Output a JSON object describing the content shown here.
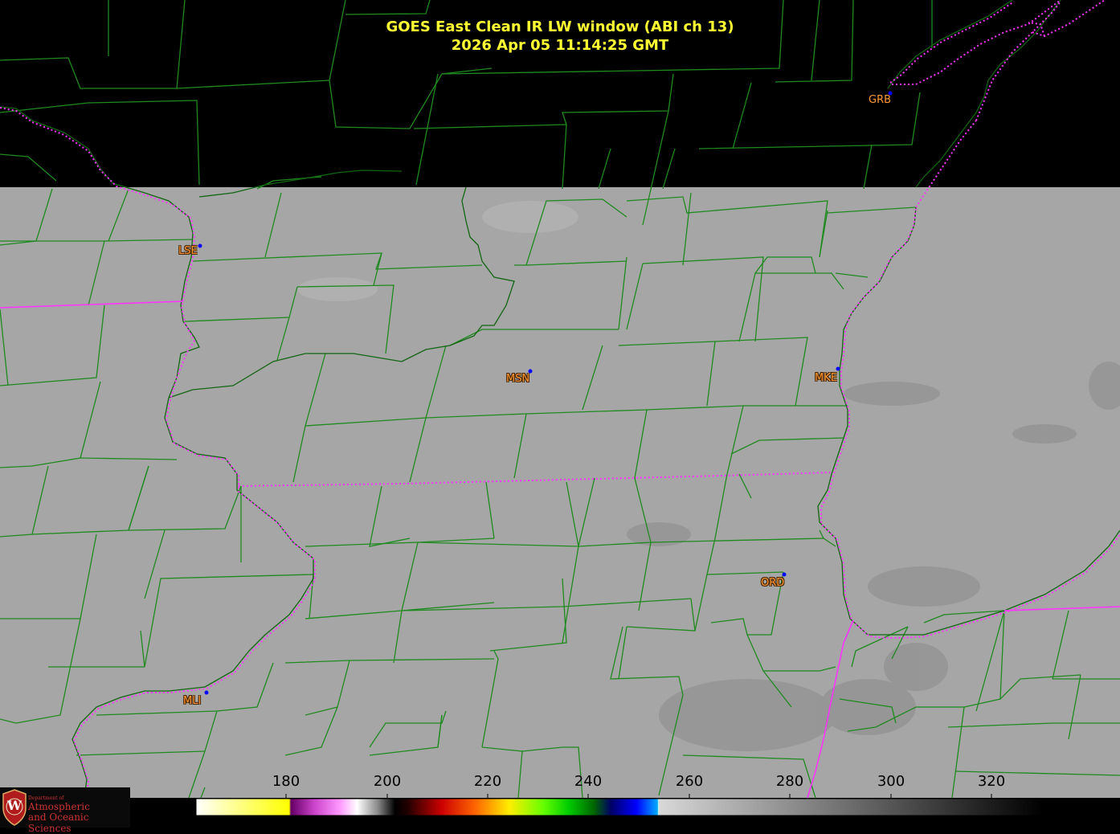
{
  "header": {
    "title_line1": "GOES East Clean IR LW window (ABI ch 13)",
    "title_line2": "2026 Apr 05  11:14:25 GMT"
  },
  "stations": [
    {
      "code": "GRB"
    },
    {
      "code": "LSE"
    },
    {
      "code": "MSN"
    },
    {
      "code": "MKE"
    },
    {
      "code": "ORD"
    },
    {
      "code": "MLI"
    }
  ],
  "colorbar": {
    "ticks": [
      "180",
      "200",
      "220",
      "240",
      "260",
      "280",
      "300",
      "320"
    ]
  },
  "logo": {
    "line_small": "Department of",
    "line1": "Atmospheric",
    "line2": "and Oceanic Sciences",
    "letter": "W"
  },
  "colors": {
    "title": "#ffff33",
    "county_lines": "#1f8a1f",
    "state_lines": "#ff33ff",
    "station_label": "#ff9933",
    "station_dot": "#0000ff"
  }
}
